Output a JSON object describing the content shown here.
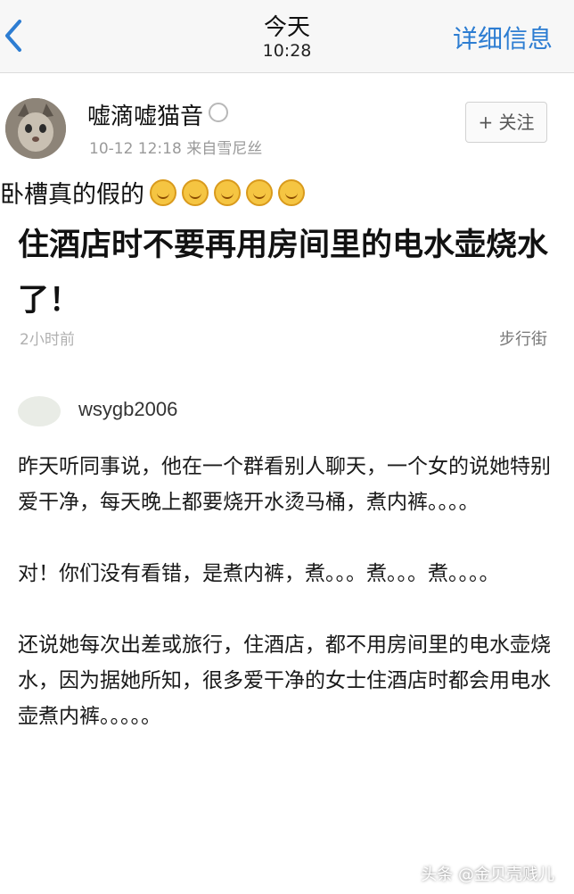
{
  "navbar": {
    "title": "今天",
    "time": "10:28",
    "detail_label": "详细信息",
    "back_icon": "chevron-left-icon",
    "accent_color": "#2d7dd2"
  },
  "post": {
    "author": "嘘滴嘘猫音",
    "meta": "10-12 12:18  来自雪尼丝",
    "follow_label": "+ 关注",
    "intro": "卧槽真的假的",
    "emoji_count": 5,
    "headline": "住酒店时不要再用房间里的电水壶烧水了！",
    "age": "2小时前",
    "source": "步行街"
  },
  "comment": {
    "username": "wsygb2006",
    "paragraphs": [
      "昨天听同事说，他在一个群看别人聊天，一个女的说她特别爱干净，每天晚上都要烧开水烫马桶，煮内裤。。。。",
      "对！你们没有看错，是煮内裤，煮。。。煮。。。煮。。。。",
      "还说她每次出差或旅行，住酒店，都不用房间里的电水壶烧水，因为据她所知，很多爱干净的女士住酒店时都会用电水壶煮内裤。。。。。"
    ]
  },
  "watermark": "头条 @金贝壳贱儿"
}
